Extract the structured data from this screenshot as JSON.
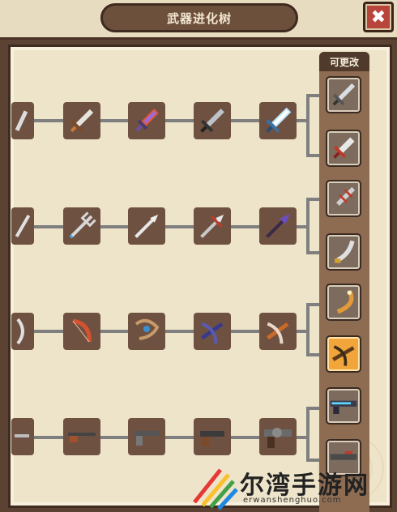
{
  "window": {
    "title": "武器进化树",
    "close_label": "✖"
  },
  "sidebar": {
    "label": "可更改",
    "choices": [
      {
        "name": "silver-sword",
        "selected": false
      },
      {
        "name": "crimson-dagger",
        "selected": false
      },
      {
        "name": "twisted-blade",
        "selected": false
      },
      {
        "name": "curved-scimitar",
        "selected": false
      },
      {
        "name": "golden-boomerang",
        "selected": false
      },
      {
        "name": "crossbow",
        "selected": true
      },
      {
        "name": "plasma-rifle",
        "selected": false
      },
      {
        "name": "heavy-rifle",
        "selected": false
      }
    ]
  },
  "tree": {
    "rows": [
      {
        "weapon_type": "sword",
        "stages": [
          "sword-1",
          "sword-2",
          "sword-3",
          "sword-4",
          "sword-5"
        ]
      },
      {
        "weapon_type": "spear",
        "stages": [
          "spear-1",
          "spear-2",
          "spear-3",
          "spear-4",
          "spear-5"
        ]
      },
      {
        "weapon_type": "bow",
        "stages": [
          "bow-1",
          "bow-2",
          "bow-3",
          "bow-4",
          "bow-5"
        ]
      },
      {
        "weapon_type": "gun",
        "stages": [
          "gun-1",
          "gun-2",
          "gun-3",
          "gun-4",
          "gun-5"
        ]
      }
    ]
  },
  "watermark": {
    "brand": "尔湾手游网",
    "domain": "erwanshenghuo.com"
  }
}
